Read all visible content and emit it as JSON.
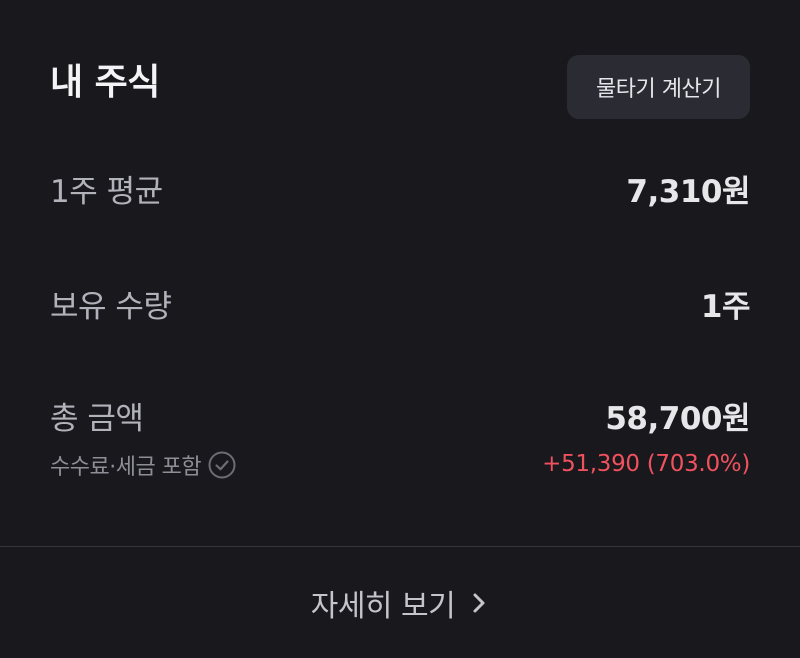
{
  "header": {
    "title": "내 주식",
    "calc_button_label": "물타기 계산기"
  },
  "rows": [
    {
      "label": "1주 평균",
      "value": "7,310원"
    },
    {
      "label": "보유 수량",
      "value": "1주"
    },
    {
      "label": "총 금액",
      "value": "58,700원"
    }
  ],
  "total": {
    "note": "수수료·세금 포함",
    "note_icon": "check-circle-icon",
    "profit": "+51,390 (703.0%)",
    "profit_color": "#f0515e"
  },
  "footer": {
    "more_label": "자세히 보기",
    "more_icon": "chevron-right-icon"
  },
  "colors": {
    "background": "#19181d",
    "button_bg": "#2b2b33",
    "divider": "#35353c"
  }
}
